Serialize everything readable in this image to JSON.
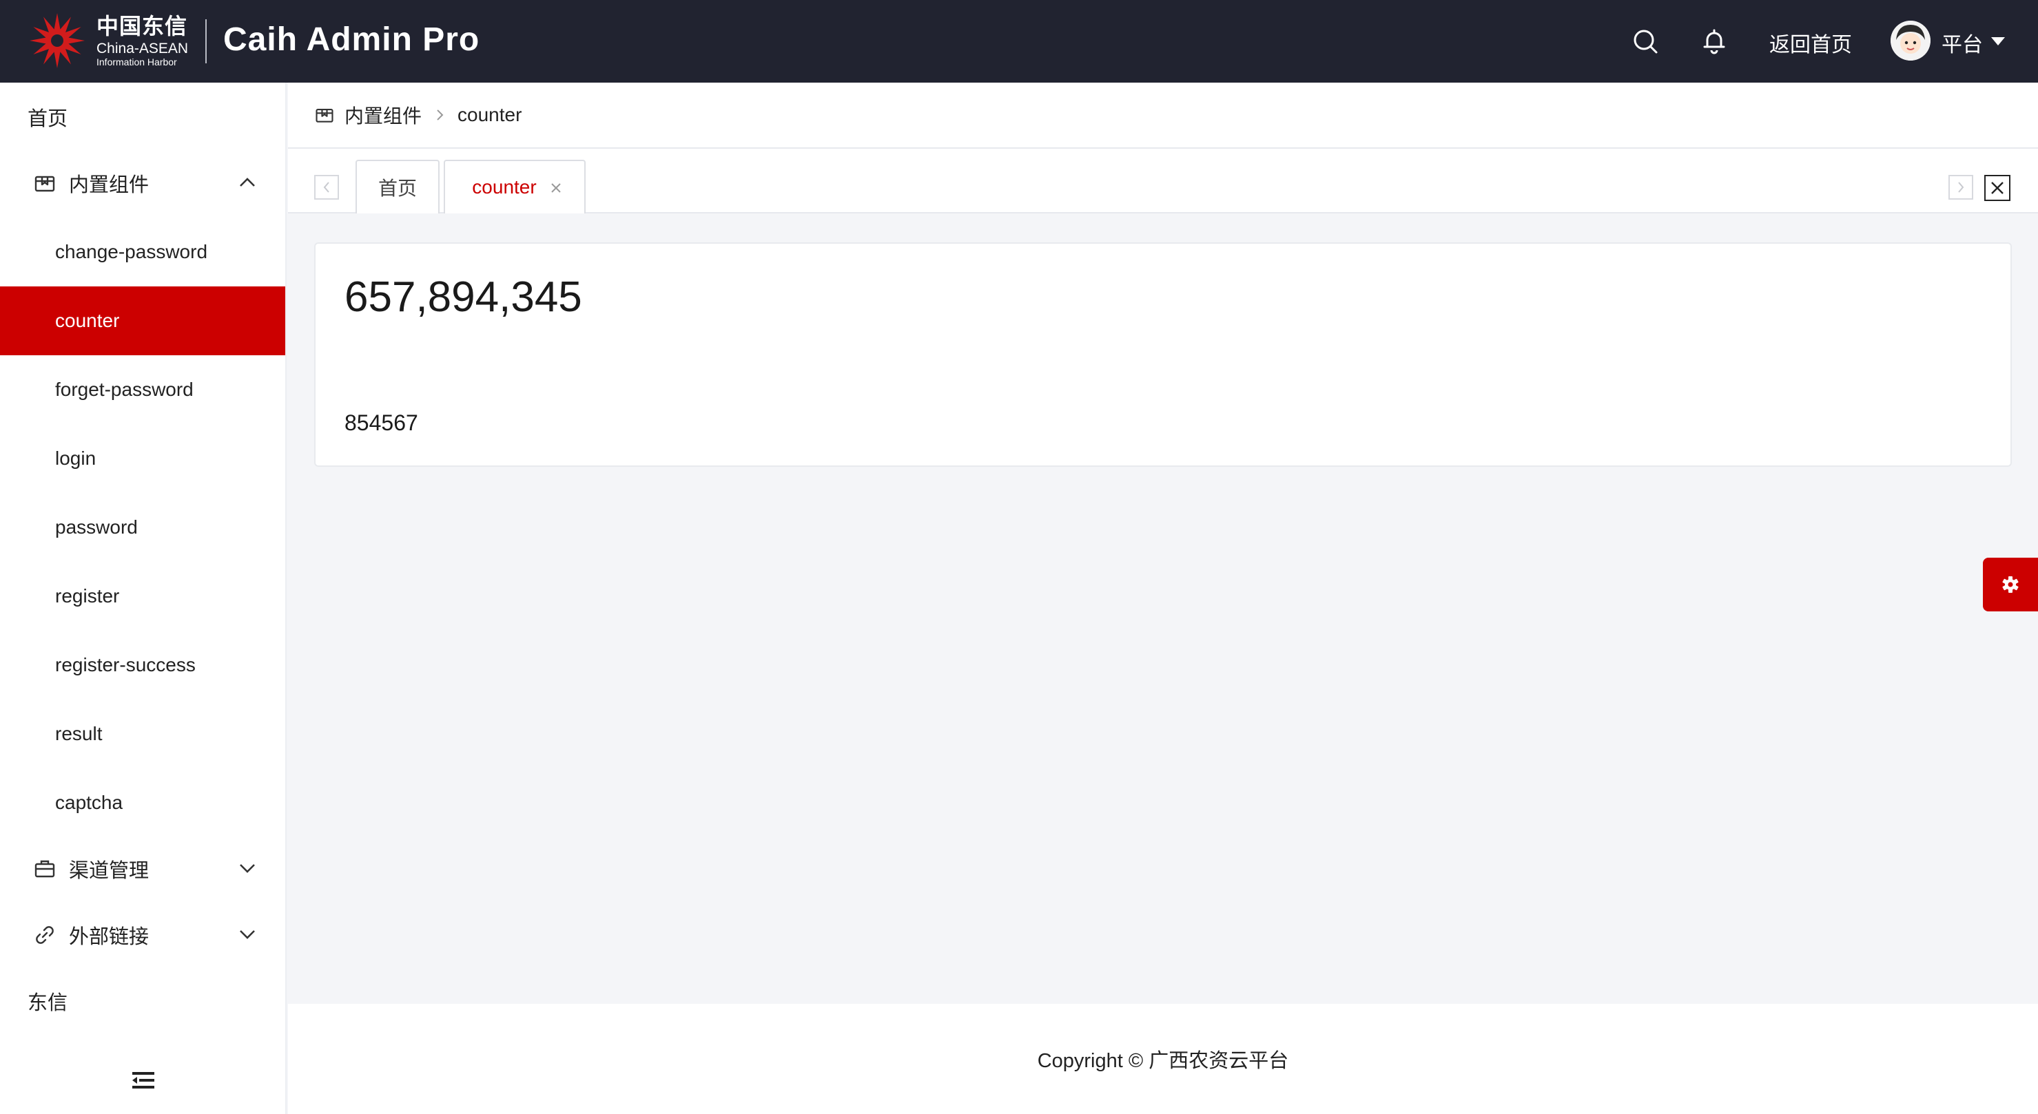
{
  "header": {
    "logo_cn": "中国东信",
    "logo_en_line1": "China-ASEAN",
    "logo_en_line2": "Information Harbor",
    "app_title": "Caih Admin Pro",
    "home_link": "返回首页",
    "user_name": "平台",
    "icons": [
      "search-icon",
      "bell-icon",
      "caret-down-icon"
    ]
  },
  "sidebar": {
    "top_item": "首页",
    "group_builtin": {
      "label": "内置组件",
      "icon": "package-icon",
      "expanded": true,
      "items": [
        {
          "label": "change-password"
        },
        {
          "label": "counter",
          "active": true
        },
        {
          "label": "forget-password"
        },
        {
          "label": "login"
        },
        {
          "label": "password"
        },
        {
          "label": "register"
        },
        {
          "label": "register-success"
        },
        {
          "label": "result"
        },
        {
          "label": "captcha"
        }
      ]
    },
    "group_channel": {
      "label": "渠道管理",
      "icon": "briefcase-icon",
      "expanded": false
    },
    "group_external": {
      "label": "外部链接",
      "icon": "link-icon",
      "expanded": false
    },
    "bottom_item": "东信",
    "active_color": "#cc0000"
  },
  "breadcrumb": {
    "parent": "内置组件",
    "current": "counter"
  },
  "tabs": {
    "items": [
      {
        "label": "首页"
      },
      {
        "label": "counter",
        "active": true
      }
    ]
  },
  "content": {
    "counter_value": "657,894,345",
    "secondary_value": "854567"
  },
  "footer": {
    "text": "Copyright © 广西农资云平台"
  },
  "colors": {
    "header_bg": "#212330",
    "accent": "#cc0000",
    "page_bg": "#f4f5f8"
  }
}
